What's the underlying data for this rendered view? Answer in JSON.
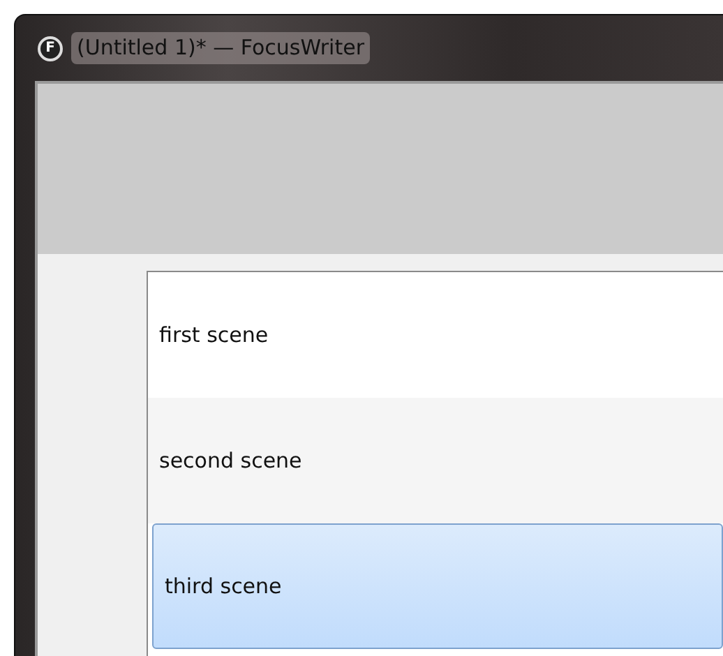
{
  "window": {
    "title": "(Untitled 1)* — FocusWriter",
    "icon_letter": "F"
  },
  "scenes": [
    {
      "label": "first scene",
      "selected": false
    },
    {
      "label": "second scene",
      "selected": false
    },
    {
      "label": "third scene",
      "selected": true
    }
  ]
}
